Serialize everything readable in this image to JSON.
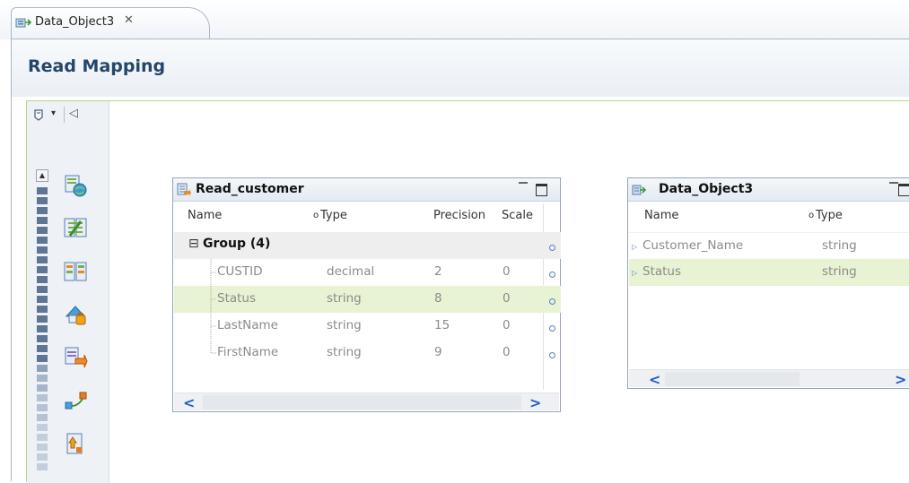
{
  "tab": {
    "label": "Data_Object3",
    "close": "✕"
  },
  "editor": {
    "title": "Read Mapping"
  },
  "palette": {
    "toolbar": {
      "dropdown_arrow": "▾",
      "collapse_arrow": "◁"
    },
    "scroll_up": "▲",
    "items": [
      {
        "icon": "read-object-icon"
      },
      {
        "icon": "expression-icon"
      },
      {
        "icon": "filter-icon"
      },
      {
        "icon": "lookup-icon"
      },
      {
        "icon": "output-object-icon"
      },
      {
        "icon": "connector-icon"
      },
      {
        "icon": "document-icon"
      }
    ]
  },
  "read_customer": {
    "title": "Read_customer",
    "columns": {
      "name": "Name",
      "marker": "o",
      "type": "Type",
      "precision": "Precision",
      "scale": "Scale"
    },
    "group": {
      "toggle": "⊟",
      "label": "Group (4)"
    },
    "rows": [
      {
        "name": "CUSTID",
        "type": "decimal",
        "precision": "2",
        "scale": "0"
      },
      {
        "name": "Status",
        "type": "string",
        "precision": "8",
        "scale": "0"
      },
      {
        "name": "LastName",
        "type": "string",
        "precision": "15",
        "scale": "0"
      },
      {
        "name": "FirstName",
        "type": "string",
        "precision": "9",
        "scale": "0"
      }
    ],
    "scroll": {
      "left": "<",
      "right": ">"
    }
  },
  "data_object3": {
    "title": "Data_Object3",
    "columns": {
      "name": "Name",
      "marker": "o",
      "type": "Type"
    },
    "rows": [
      {
        "name": "Customer_Name",
        "type": "string"
      },
      {
        "name": "Status",
        "type": "string"
      }
    ],
    "port_marker": "▷",
    "scroll": {
      "left": "<",
      "right": ">"
    }
  },
  "colors": {
    "title": "#24466b",
    "highlight": "#e7f3d3",
    "canvas_border": "#b7d981",
    "scroll_arrow": "#1f5ec9",
    "port": "#5b7ec4"
  }
}
